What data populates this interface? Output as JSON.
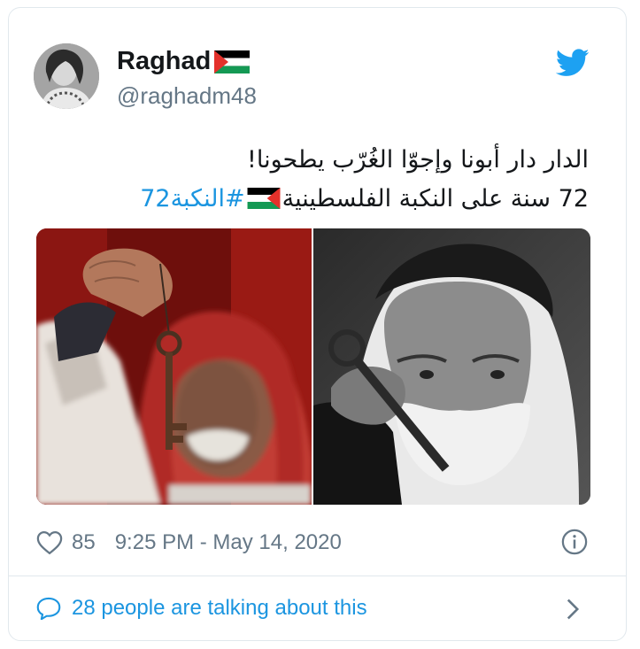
{
  "user": {
    "display_name": "Raghad",
    "handle": "@raghadm48"
  },
  "tweet": {
    "line1": "الدار دار أبونا وإجوّا الغُرّب يطحونا!",
    "line2_prefix": "72 سنة على النكبة الفلسطينية",
    "hashtag": "#النكبة72"
  },
  "stats": {
    "likes": "85",
    "timestamp": "9:25 PM - May 14, 2020"
  },
  "footer": {
    "talking": "28 people are talking about this"
  },
  "colors": {
    "twitter_blue": "#1da1f2",
    "link_blue": "#1b95e0",
    "muted": "#657786",
    "border": "#e1e8ed"
  },
  "icons": [
    "twitter-bird-icon",
    "palestine-flag-icon",
    "heart-icon",
    "info-icon",
    "speech-bubble-icon",
    "chevron-right-icon"
  ]
}
